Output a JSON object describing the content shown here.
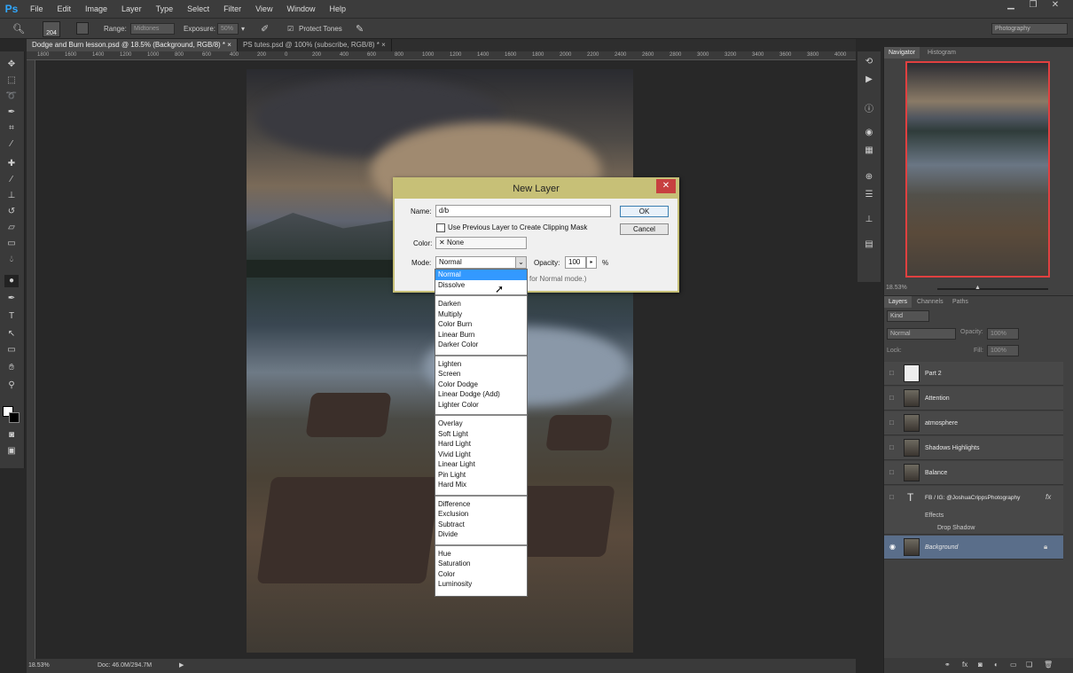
{
  "app": {
    "logo": "Ps",
    "workspace": "Photography"
  },
  "menu": [
    "File",
    "Edit",
    "Image",
    "Layer",
    "Type",
    "Select",
    "Filter",
    "View",
    "Window",
    "Help"
  ],
  "options": {
    "brush_size": "204",
    "range_label": "Range:",
    "range_value": "Midtones",
    "exposure_label": "Exposure:",
    "exposure_value": "50%",
    "protect_tones": "Protect Tones"
  },
  "tabs": [
    {
      "label": "Dodge and Burn lesson.psd @ 18.5% (Background, RGB/8) *",
      "close": "×"
    },
    {
      "label": "PS tutes.psd @ 100% (subscribe, RGB/8) *",
      "close": "×"
    }
  ],
  "ruler_ticks": [
    "1800",
    "1600",
    "1400",
    "1200",
    "1000",
    "800",
    "600",
    "400",
    "200",
    "0",
    "200",
    "400",
    "600",
    "800",
    "1000",
    "1200",
    "1400",
    "1600",
    "1800",
    "2000",
    "2200",
    "2400",
    "2600",
    "2800",
    "3000",
    "3200",
    "3400",
    "3600",
    "3800",
    "4000"
  ],
  "status": {
    "zoom": "18.53%",
    "doc": "Doc: 46.0M/294.7M"
  },
  "navigator": {
    "tab1": "Navigator",
    "tab2": "Histogram",
    "zoom": "18.53%"
  },
  "layers_panel": {
    "tabs": [
      "Layers",
      "Channels",
      "Paths"
    ],
    "kind": "Kind",
    "blend": "Normal",
    "opacity_label": "Opacity:",
    "opacity_value": "100%",
    "lock_label": "Lock:",
    "fill_label": "Fill:",
    "fill_value": "100%",
    "layers": [
      {
        "name": "Part 2"
      },
      {
        "name": "Attention"
      },
      {
        "name": "atmosphere"
      },
      {
        "name": "Shadows Highlights"
      },
      {
        "name": "Balance"
      },
      {
        "name": "FB / IG: @JoshuaCrippsPhotography",
        "fx": "fx"
      },
      {
        "name": "Background"
      }
    ],
    "effects_label": "Effects",
    "drop_shadow_label": "Drop Shadow"
  },
  "dialog": {
    "title": "New Layer",
    "close": "✕",
    "name_label": "Name:",
    "name_value": "d/b",
    "clipping_label": "Use Previous Layer to Create Clipping Mask",
    "color_label": "Color:",
    "color_value": "None",
    "mode_label": "Mode:",
    "mode_value": "Normal",
    "opacity_label": "Opacity:",
    "opacity_value": "100",
    "percent": "%",
    "hint": "for Normal mode.)",
    "ok": "OK",
    "cancel": "Cancel"
  },
  "mode_options": [
    [
      "Normal",
      "Dissolve"
    ],
    [
      "Darken",
      "Multiply",
      "Color Burn",
      "Linear Burn",
      "Darker Color"
    ],
    [
      "Lighten",
      "Screen",
      "Color Dodge",
      "Linear Dodge (Add)",
      "Lighter Color"
    ],
    [
      "Overlay",
      "Soft Light",
      "Hard Light",
      "Vivid Light",
      "Linear Light",
      "Pin Light",
      "Hard Mix"
    ],
    [
      "Difference",
      "Exclusion",
      "Subtract",
      "Divide"
    ],
    [
      "Hue",
      "Saturation",
      "Color",
      "Luminosity"
    ]
  ]
}
